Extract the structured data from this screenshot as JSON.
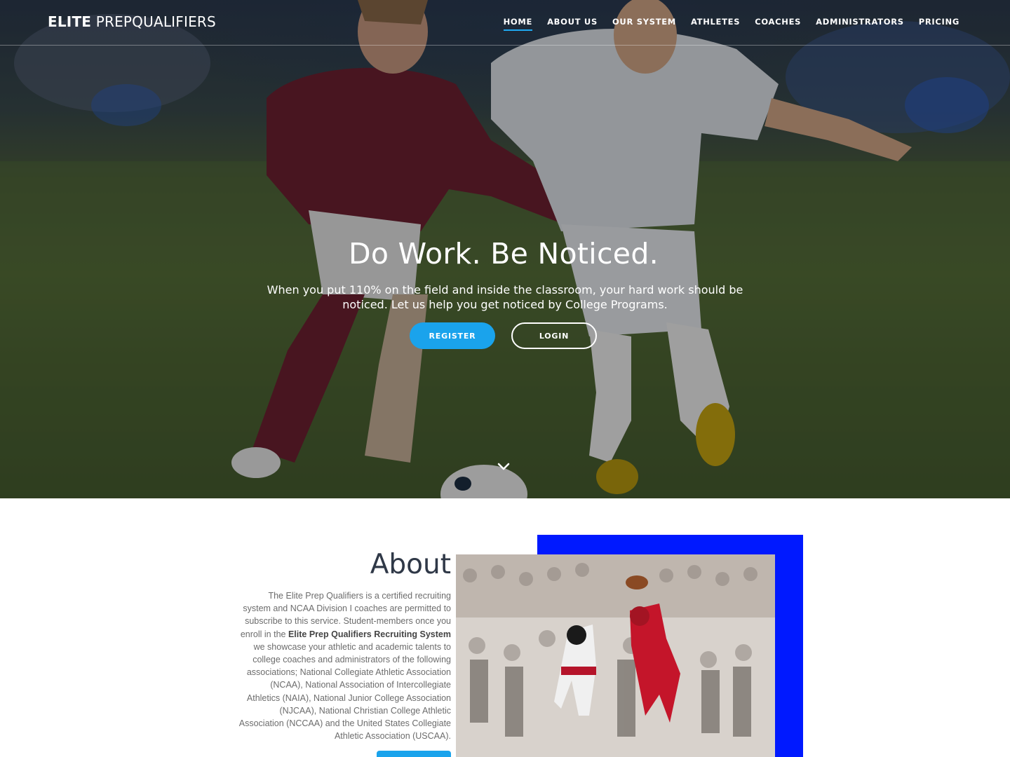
{
  "brand": {
    "bold": "ELITE",
    "light": "PREPQUALIFIERS"
  },
  "nav": {
    "items": [
      {
        "label": "HOME",
        "active": true
      },
      {
        "label": "ABOUT US",
        "active": false
      },
      {
        "label": "OUR SYSTEM",
        "active": false
      },
      {
        "label": "ATHLETES",
        "active": false
      },
      {
        "label": "COACHES",
        "active": false
      },
      {
        "label": "ADMINISTRATORS",
        "active": false
      },
      {
        "label": "PRICING",
        "active": false
      }
    ]
  },
  "hero": {
    "title": "Do Work. Be Noticed.",
    "subtitle": "When you put 110% on the field and inside the classroom, your hard work should be noticed. Let us help you get noticed by College Programs.",
    "register_label": "REGISTER",
    "login_label": "LOGIN",
    "scroll_icon": "chevron-down-icon"
  },
  "about": {
    "heading": "About",
    "text_intro": "The Elite Prep Qualifiers is a certified recruiting system and NCAA Division I coaches are permitted to subscribe to this service. Student-members once you enroll in the ",
    "text_bold": "Elite Prep Qualifiers Recruiting System",
    "text_rest": " we showcase your athletic and academic talents to college coaches and administrators of the following associations; National Collegiate Athletic Association (NCAA), National Association of Intercollegiate Athletics (NAIA), National Junior College Association (NJCAA), National Christian College Athletic Association (NCCAA) and the United States Collegiate Athletic Association (USCAA)."
  },
  "colors": {
    "accent": "#1aa3ec",
    "frame_blue": "#0019ff",
    "heading": "#2f3847"
  }
}
